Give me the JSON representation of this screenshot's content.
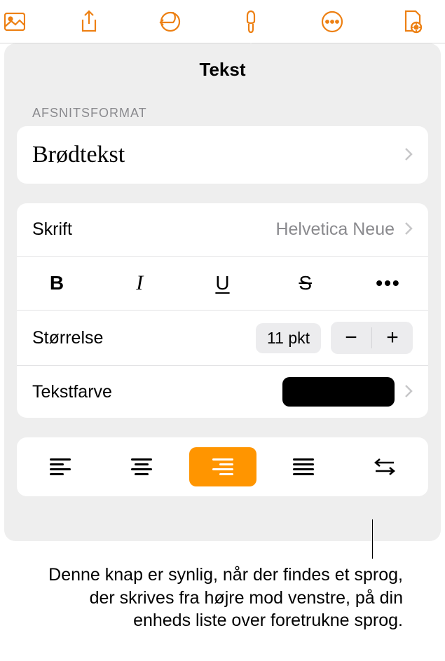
{
  "toolbar": {
    "icons": {
      "media": "media-icon",
      "share": "share-icon",
      "undo": "undo-icon",
      "format": "format-brush-icon",
      "more": "more-circle-icon",
      "document": "document-icon"
    }
  },
  "panel": {
    "title": "Tekst",
    "section_label": "AFSNITSFORMAT",
    "paragraph_style": "Brødtekst",
    "font": {
      "label": "Skrift",
      "value": "Helvetica Neue"
    },
    "style_buttons": {
      "bold": "B",
      "italic": "I",
      "underline": "U",
      "strike": "S",
      "more": "•••"
    },
    "size": {
      "label": "Størrelse",
      "value": "11 pkt",
      "minus": "−",
      "plus": "+"
    },
    "text_color": {
      "label": "Tekstfarve",
      "swatch": "#000000"
    },
    "alignment": {
      "selected": "right",
      "options": [
        "left",
        "center",
        "right",
        "justify",
        "rtl"
      ]
    }
  },
  "callout": {
    "text": "Denne knap er synlig, når der findes et sprog, der skrives fra højre mod venstre, på din enheds liste over foretrukne sprog."
  },
  "colors": {
    "accent": "#ed8013",
    "selected": "#ff9500"
  }
}
